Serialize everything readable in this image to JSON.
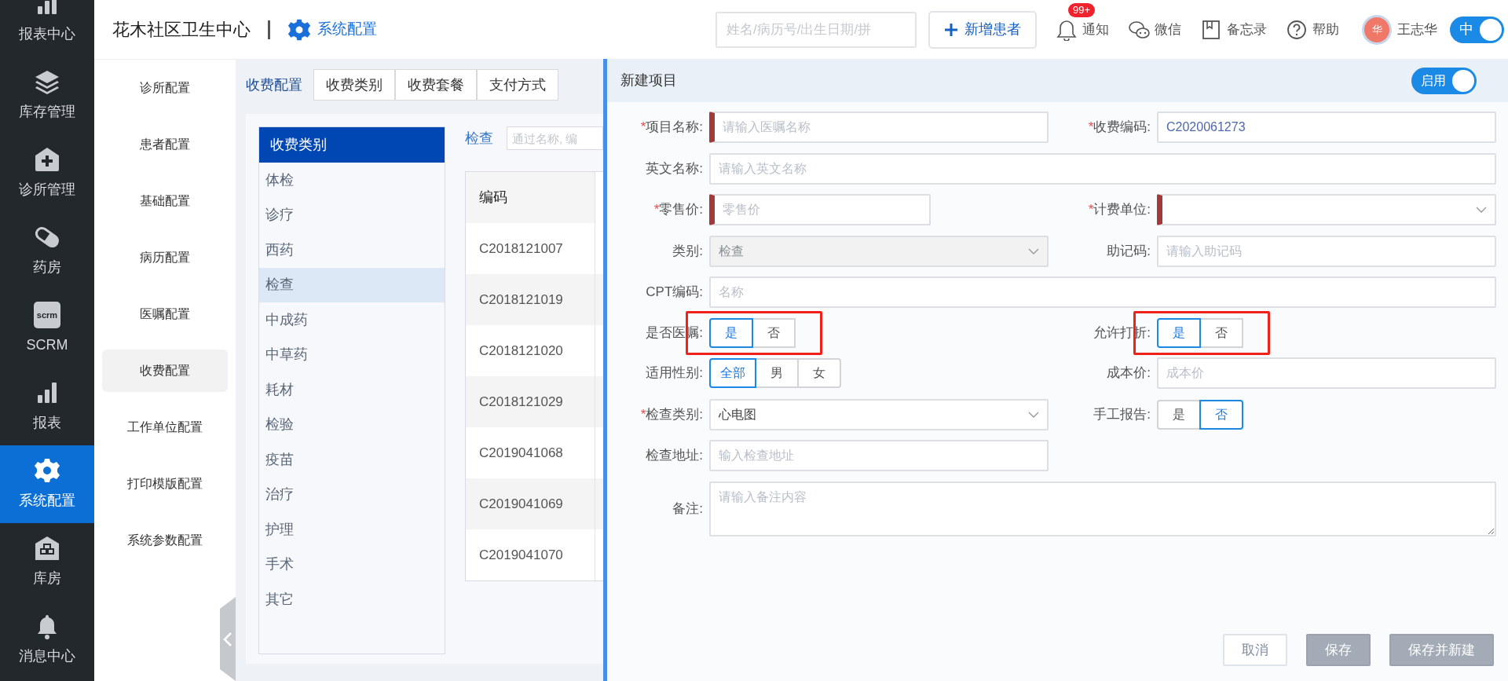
{
  "nav": {
    "items": [
      {
        "label": "报表中心",
        "kind": "chart",
        "selected": false
      },
      {
        "label": "库存管理",
        "kind": "stack",
        "selected": false
      },
      {
        "label": "诊所管理",
        "kind": "clinic",
        "selected": false
      },
      {
        "label": "药房",
        "kind": "pill",
        "selected": false
      },
      {
        "label": "SCRM",
        "kind": "scrm",
        "icon_text": "scrm",
        "selected": false
      },
      {
        "label": "报表",
        "kind": "chart",
        "selected": false
      },
      {
        "label": "系统配置",
        "kind": "gear",
        "selected": true
      },
      {
        "label": "库房",
        "kind": "warehouse",
        "selected": false
      },
      {
        "label": "消息中心",
        "kind": "bell",
        "selected": false
      }
    ]
  },
  "header": {
    "title": "花木社区卫生中心",
    "section": "系统配置",
    "search": {
      "placeholder": "姓名/病历号/出生日期/拼"
    },
    "new_button": "新增患者",
    "tools": [
      {
        "kind": "bell",
        "label": "通知",
        "badge": "99+"
      },
      {
        "kind": "wechat",
        "label": "微信"
      },
      {
        "kind": "book",
        "label": "备忘录"
      },
      {
        "kind": "help",
        "label": "帮助"
      }
    ],
    "user": {
      "avatar": "华",
      "name": "王志华"
    },
    "lang_toggle": {
      "label": "中",
      "on": true
    }
  },
  "subnav": [
    {
      "label": "诊所配置",
      "selected": false
    },
    {
      "label": "患者配置",
      "selected": false
    },
    {
      "label": "基础配置",
      "selected": false
    },
    {
      "label": "病历配置",
      "selected": false
    },
    {
      "label": "医嘱配置",
      "selected": false
    },
    {
      "label": "收费配置",
      "selected": true
    },
    {
      "label": "工作单位配置",
      "selected": false
    },
    {
      "label": "打印模版配置",
      "selected": false
    },
    {
      "label": "系统参数配置",
      "selected": false
    }
  ],
  "tabs": {
    "label": "收费配置",
    "items": [
      {
        "label": "收费类别",
        "selected": false
      },
      {
        "label": "收费套餐",
        "selected": false
      },
      {
        "label": "支付方式",
        "selected": false
      }
    ]
  },
  "categories": {
    "header": "收费类别",
    "items": [
      {
        "label": "体检",
        "selected": false
      },
      {
        "label": "诊疗",
        "selected": false
      },
      {
        "label": "西药",
        "selected": false
      },
      {
        "label": "检查",
        "selected": true
      },
      {
        "label": "中成药",
        "selected": false
      },
      {
        "label": "中草药",
        "selected": false
      },
      {
        "label": "耗材",
        "selected": false
      },
      {
        "label": "检验",
        "selected": false
      },
      {
        "label": "疫苗",
        "selected": false
      },
      {
        "label": "治疗",
        "selected": false
      },
      {
        "label": "护理",
        "selected": false
      },
      {
        "label": "手术",
        "selected": false
      },
      {
        "label": "其它",
        "selected": false
      }
    ]
  },
  "filter": {
    "label": "检查",
    "placeholder": "通过名称, 编"
  },
  "table": {
    "columns": [
      "编码"
    ],
    "rows": [
      [
        "C2018121007"
      ],
      [
        "C2018121019"
      ],
      [
        "C2018121020"
      ],
      [
        "C2018121029"
      ],
      [
        "C2019041068"
      ],
      [
        "C2019041069"
      ],
      [
        "C2019041070"
      ]
    ]
  },
  "panel": {
    "title": "新建项目",
    "enabled": {
      "label": "启用",
      "on": true
    },
    "rows": [
      [
        {
          "label": "项目名称:",
          "kind": "input",
          "mark": "*",
          "invalid": true,
          "placeholder": "请输入医嘱名称"
        },
        {
          "label": "收费编码:",
          "kind": "input",
          "mark": "*",
          "value": "C2020061273"
        }
      ],
      [
        {
          "label": "英文名称:",
          "kind": "input",
          "wide": true,
          "placeholder": "请输入英文名称"
        }
      ],
      [
        {
          "label": "零售价:",
          "kind": "short",
          "mark": "*",
          "invalid": true,
          "placeholder": "零售价"
        },
        {
          "label": "计费单位:",
          "kind": "select",
          "mark": "*",
          "invalid": true
        }
      ],
      [
        {
          "label": "类别:",
          "kind": "select",
          "disabled": true,
          "value": "检查"
        },
        {
          "label": "助记码:",
          "kind": "input",
          "placeholder": "请输入助记码"
        }
      ],
      [
        {
          "label": "CPT编码:",
          "kind": "input",
          "wide": true,
          "placeholder": "名称"
        }
      ],
      [
        {
          "label": "是否医嘱:",
          "kind": "segment",
          "highlighted": true,
          "options": [
            {
              "label": "是",
              "selected": true
            },
            {
              "label": "否",
              "selected": false
            }
          ]
        },
        {
          "label": "允许打折:",
          "kind": "segment",
          "highlighted": true,
          "options": [
            {
              "label": "是",
              "selected": true
            },
            {
              "label": "否",
              "selected": false
            }
          ]
        }
      ],
      [
        {
          "label": "适用性别:",
          "kind": "segment",
          "options": [
            {
              "label": "全部",
              "selected": true
            },
            {
              "label": "男",
              "selected": false
            },
            {
              "label": "女",
              "selected": false
            }
          ]
        },
        {
          "label": "成本价:",
          "kind": "input",
          "placeholder": "成本价"
        }
      ],
      [
        {
          "label": "检查类别:",
          "kind": "select",
          "mark": "*",
          "value": "心电图"
        },
        {
          "label": "手工报告:",
          "kind": "segment",
          "options": [
            {
              "label": "是",
              "selected": false
            },
            {
              "label": "否",
              "selected": true
            }
          ]
        }
      ],
      [
        {
          "label": "检查地址:",
          "kind": "input",
          "placeholder": "输入检查地址"
        }
      ],
      [
        {
          "label": "备注:",
          "kind": "textarea",
          "wide": true,
          "placeholder": "请输入备注内容"
        }
      ]
    ],
    "buttons": [
      {
        "label": "取消",
        "kind": "outline",
        "disabled": false
      },
      {
        "label": "保存",
        "kind": "solid",
        "disabled": true
      },
      {
        "label": "保存并新建",
        "kind": "solid",
        "disabled": true
      }
    ]
  }
}
